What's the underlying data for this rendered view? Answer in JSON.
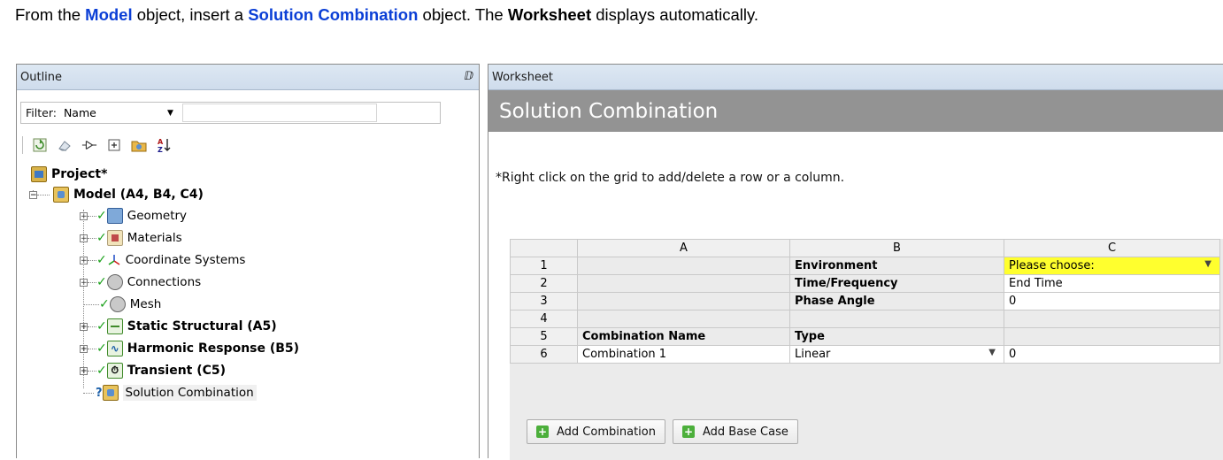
{
  "intro": {
    "t1": "From the ",
    "model": "Model",
    "t2": " object, insert a ",
    "solution_combination": "Solution Combination",
    "t3": " object. The ",
    "worksheet": "Worksheet",
    "t4": " displays automatically."
  },
  "outline": {
    "title": "Outline",
    "pin_glyph": "ⅅ",
    "filter_label": "Filter:",
    "filter_value": "Name",
    "filter_text": "",
    "tree": {
      "project": "Project*",
      "model": "Model (A4, B4, C4)",
      "geometry": "Geometry",
      "materials": "Materials",
      "coordinate_systems": "Coordinate Systems",
      "connections": "Connections",
      "mesh": "Mesh",
      "static_structural": "Static Structural (A5)",
      "harmonic_response": "Harmonic Response (B5)",
      "transient": "Transient (C5)",
      "solution_combination": "Solution Combination"
    }
  },
  "worksheet": {
    "title": "Worksheet",
    "heading": "Solution Combination",
    "note": "*Right click on the grid to add/delete a row or a column.",
    "grid": {
      "col_headers": [
        "A",
        "B",
        "C"
      ],
      "rows": [
        {
          "num": "1",
          "a": "",
          "b": "Environment",
          "c": "Please choose:"
        },
        {
          "num": "2",
          "a": "",
          "b": "Time/Frequency",
          "c": "End Time"
        },
        {
          "num": "3",
          "a": "",
          "b": "Phase Angle",
          "c": "0"
        },
        {
          "num": "4",
          "a": "",
          "b": "",
          "c": ""
        },
        {
          "num": "5",
          "a": "Combination Name",
          "b": "Type",
          "c": ""
        },
        {
          "num": "6",
          "a": "Combination 1",
          "b": "Linear",
          "c": "0"
        }
      ]
    },
    "buttons": {
      "add_combination": "Add Combination",
      "add_base_case": "Add Base Case"
    }
  },
  "colors": {
    "intro_link": "#0b3fd6",
    "highlight_yellow": "#ffff2e",
    "title_bar_gray": "#939393",
    "check_green": "#1aa11a"
  }
}
